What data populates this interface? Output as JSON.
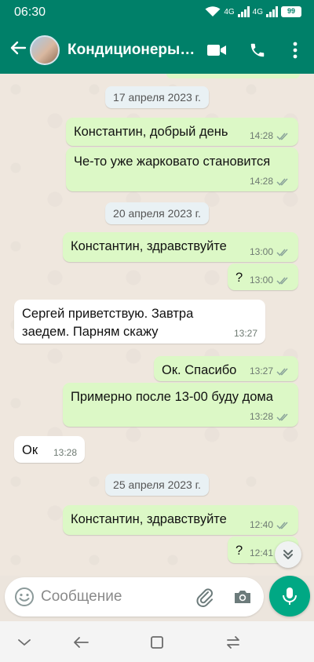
{
  "status_bar": {
    "time": "06:30",
    "net1": "4G",
    "net2": "4G",
    "battery": "99"
  },
  "header": {
    "title": "Кондиционеры…",
    "icons": [
      "back-arrow-icon",
      "avatar",
      "video-call-icon",
      "phone-icon",
      "more-vert-icon"
    ]
  },
  "chat": {
    "dates": [
      "17 апреля 2023 г.",
      "20 апреля 2023 г.",
      "25 апреля 2023 г."
    ],
    "messages": [
      {
        "dir": "out",
        "text": "Константин, добрый день",
        "time": "14:28"
      },
      {
        "dir": "out",
        "text": "Че-то уже жарковато становится",
        "time": "14:28"
      },
      {
        "dir": "out",
        "text": "Константин, здравствуйте",
        "time": "13:00"
      },
      {
        "dir": "out",
        "text": "?",
        "time": "13:00"
      },
      {
        "dir": "in",
        "text": "Сергей приветствую. Завтра заедем. Парням скажу",
        "time": "13:27"
      },
      {
        "dir": "out",
        "text": "Ок. Спасибо",
        "time": "13:27"
      },
      {
        "dir": "out",
        "text": "Примерно после 13-00 буду дома",
        "time": "13:28"
      },
      {
        "dir": "in",
        "text": "Ок",
        "time": "13:28"
      },
      {
        "dir": "out",
        "text": "Константин, здравствуйте",
        "time": "12:40"
      },
      {
        "dir": "out",
        "text": "?",
        "time": "12:41"
      }
    ]
  },
  "composer": {
    "placeholder": "Сообщение",
    "icons": [
      "emoji-icon",
      "attach-icon",
      "camera-icon",
      "mic-icon"
    ]
  },
  "colors": {
    "header": "#008069",
    "outgoing_bubble": "#dcf8c6",
    "incoming_bubble": "#ffffff",
    "mic_button": "#00a884",
    "read_ticks": "#53bdeb"
  }
}
